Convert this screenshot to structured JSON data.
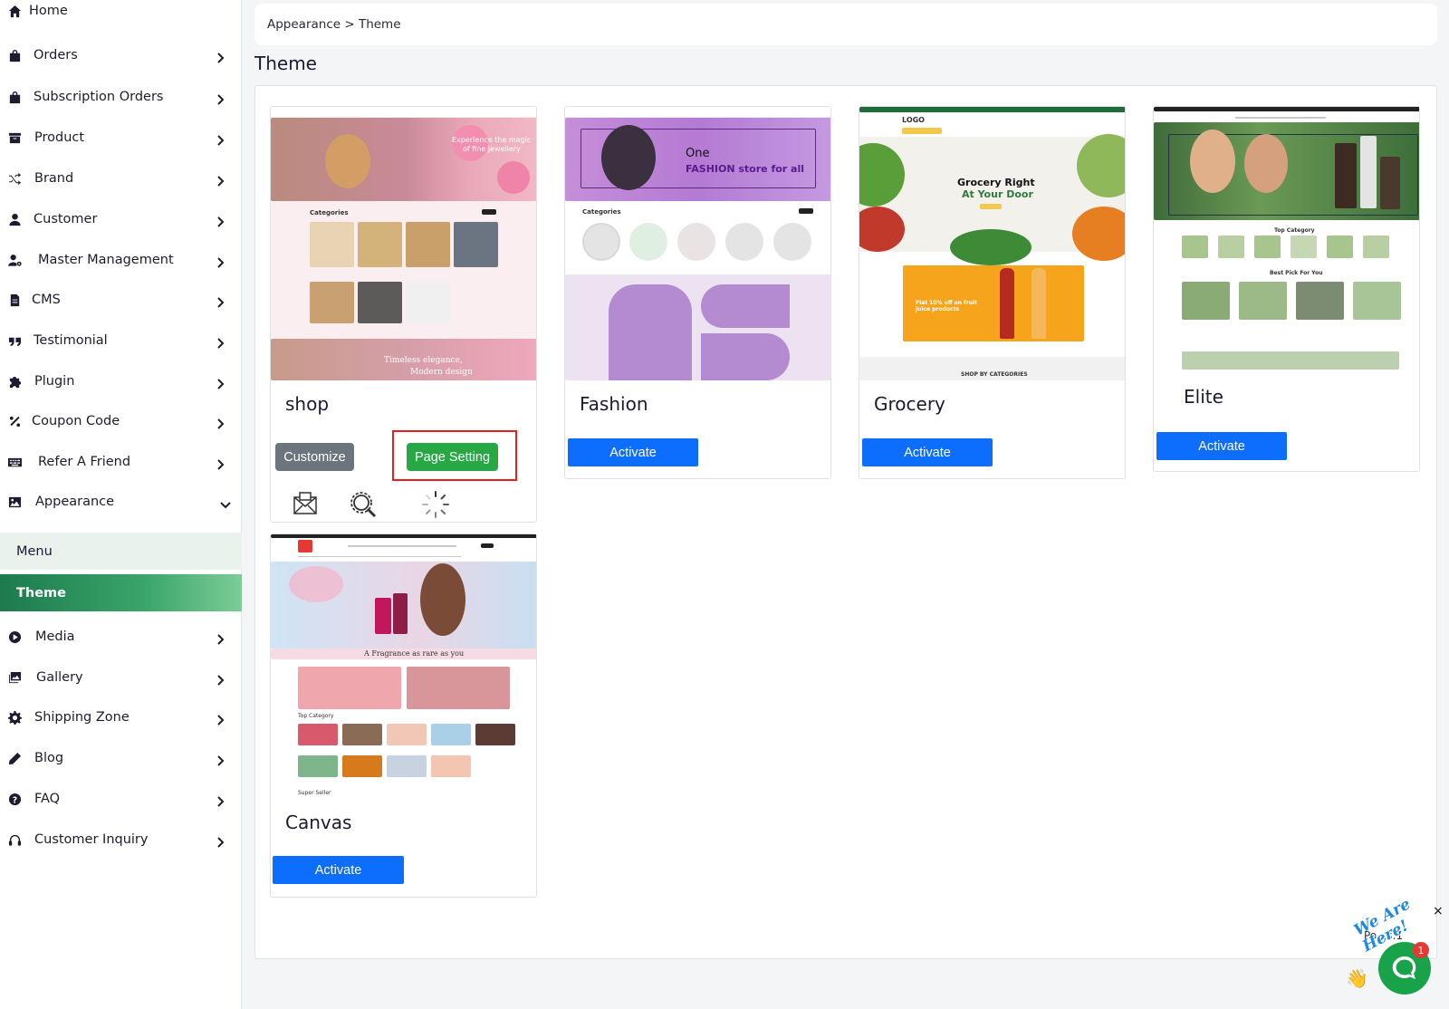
{
  "sidebar": {
    "items": [
      {
        "label": "Home",
        "icon": "home-icon"
      },
      {
        "label": "Orders",
        "icon": "bag-icon"
      },
      {
        "label": "Subscription Orders",
        "icon": "bag-icon"
      },
      {
        "label": "Product",
        "icon": "box-icon"
      },
      {
        "label": "Brand",
        "icon": "shuffle-icon"
      },
      {
        "label": "Customer",
        "icon": "user-icon"
      },
      {
        "label": "Master Management",
        "icon": "user-gear-icon"
      },
      {
        "label": "CMS",
        "icon": "file-icon"
      },
      {
        "label": "Testimonial",
        "icon": "quote-icon"
      },
      {
        "label": "Plugin",
        "icon": "puzzle-icon"
      },
      {
        "label": "Coupon Code",
        "icon": "percent-icon"
      },
      {
        "label": "Refer A Friend",
        "icon": "keyboard-icon"
      },
      {
        "label": "Appearance",
        "icon": "image-icon"
      },
      {
        "label": "Media",
        "icon": "play-circle-icon"
      },
      {
        "label": "Gallery",
        "icon": "images-icon"
      },
      {
        "label": "Shipping Zone",
        "icon": "gear-icon"
      },
      {
        "label": "Blog",
        "icon": "pencil-icon"
      },
      {
        "label": "FAQ",
        "icon": "question-icon"
      },
      {
        "label": "Customer Inquiry",
        "icon": "headset-icon"
      }
    ],
    "appearance_sub": [
      {
        "label": "Menu"
      },
      {
        "label": "Theme"
      }
    ]
  },
  "breadcrumb": {
    "text": "Appearance > Theme"
  },
  "page": {
    "title": "Theme"
  },
  "themes": {
    "shop": {
      "name": "shop",
      "customize_label": "Customize",
      "page_setting_label": "Page Setting",
      "hero_text_1": "Experience the magic",
      "hero_text_2": "of fine jewellery",
      "categories_label": "Categories",
      "footer_text_1": "Timeless elegance,",
      "footer_text_2": "Modern design"
    },
    "fashion": {
      "name": "Fashion",
      "activate_label": "Activate",
      "hero_text_1": "One",
      "hero_text_2": "FASHION store for all",
      "categories_label": "Categories"
    },
    "grocery": {
      "name": "Grocery",
      "activate_label": "Activate",
      "logo_text": "LOGO",
      "hero_text_1": "Grocery Right",
      "hero_text_2": "At Your Door",
      "promo_text": "Flat 10% off on fruit juice products",
      "section_label": "SHOP BY CATEGORIES"
    },
    "elite": {
      "name": "Elite",
      "activate_label": "Activate",
      "section_1": "Top Category",
      "section_2": "Best Pick For You"
    },
    "canvas": {
      "name": "Canvas",
      "activate_label": "Activate",
      "tagline": "A Fragrance as rare as you",
      "section_1": "Top Category",
      "section_2": "Super Seller"
    }
  },
  "chat": {
    "greeting": "We Are Here!",
    "badge_count": "1",
    "close_label": "×",
    "fragment": "Po...s.1"
  },
  "colors": {
    "primary": "#0d6efd",
    "success": "#28a745",
    "secondary": "#6c757d",
    "active_nav": "#1d7a4d",
    "highlight": "#e32020"
  }
}
